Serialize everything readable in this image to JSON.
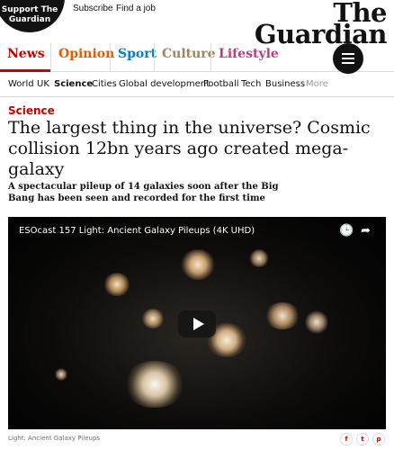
{
  "header": {
    "support_line1": "Support The",
    "support_line2": "Guardian",
    "subscribe": "Subscribe",
    "find_job": "Find a job",
    "logo_line1": "The",
    "logo_line2": "Guardian"
  },
  "pillars": [
    {
      "label": "News",
      "color": "#c70000"
    },
    {
      "label": "Opinion",
      "color": "#e05e00"
    },
    {
      "label": "Sport",
      "color": "#0084c6"
    },
    {
      "label": "Culture",
      "color": "#a1845c"
    },
    {
      "label": "Lifestyle",
      "color": "#bb3b80"
    }
  ],
  "subnav": [
    "World",
    "UK",
    "Science",
    "Cities",
    "Global development",
    "Football",
    "Tech",
    "Business",
    "More"
  ],
  "article": {
    "section": "Science",
    "headline": "The largest thing in the universe? Cosmic collision 12bn years ago created mega-galaxy",
    "standfirst": "A spectacular pileup of 14 galaxies soon after the Big Bang has been seen and recorded for the first time"
  },
  "video": {
    "title": "ESOcast 157 Light: Ancient Galaxy Pileups (4K UHD)",
    "clock_icon": "clock-icon",
    "share_icon": "share-icon",
    "play_icon": "play-icon"
  },
  "caption": "Light: Ancient Galaxy Pileups",
  "share": {
    "facebook": "f",
    "twitter": "t",
    "pinterest": "p"
  }
}
